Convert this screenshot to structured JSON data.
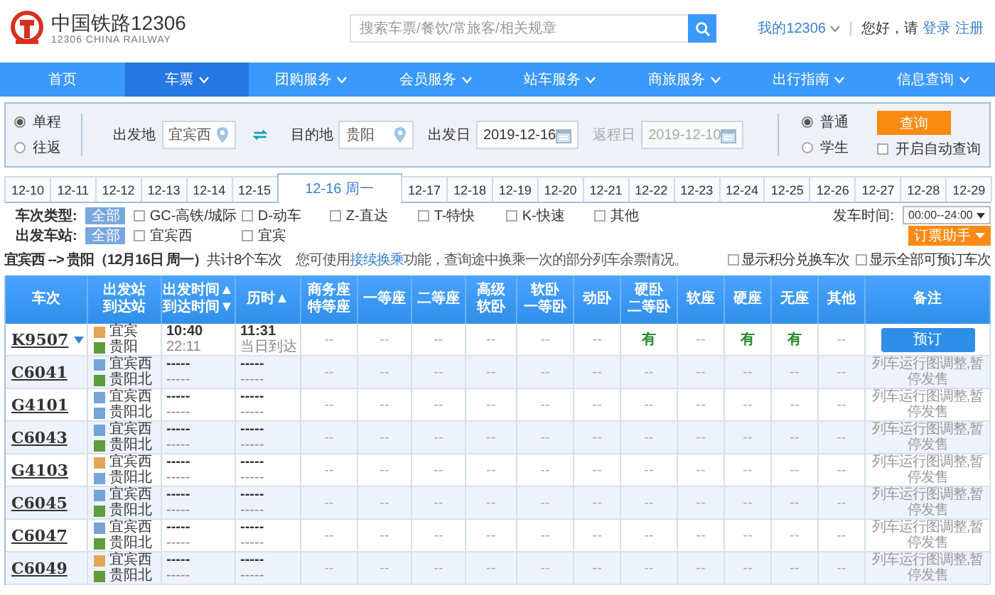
{
  "header": {
    "title": "中国铁路12306",
    "subtitle": "12306 CHINA RAILWAY",
    "search": {
      "placeholder": "搜索车票/餐饮/常旅客/相关规章"
    },
    "account": "我的12306",
    "greeting": "您好，请",
    "login": "登录",
    "register": "注册"
  },
  "nav": [
    {
      "label": "首页",
      "selected": false,
      "dropdown": false
    },
    {
      "label": "车票",
      "selected": true,
      "dropdown": true
    },
    {
      "label": "团购服务",
      "selected": false,
      "dropdown": true
    },
    {
      "label": "会员服务",
      "selected": false,
      "dropdown": true
    },
    {
      "label": "站车服务",
      "selected": false,
      "dropdown": true
    },
    {
      "label": "商旅服务",
      "selected": false,
      "dropdown": true
    },
    {
      "label": "出行指南",
      "selected": false,
      "dropdown": true
    },
    {
      "label": "信息查询",
      "selected": false,
      "dropdown": true
    }
  ],
  "query": {
    "trip_types": [
      {
        "label": "单程",
        "selected": true
      },
      {
        "label": "往返",
        "selected": false
      }
    ],
    "from": {
      "label": "出发地",
      "value": "宜宾西"
    },
    "to": {
      "label": "目的地",
      "value": "贵阳"
    },
    "depart": {
      "label": "出发日",
      "value": "2019-12-16",
      "disabled": false
    },
    "return": {
      "label": "返程日",
      "value": "2019-12-10",
      "disabled": true
    },
    "passenger_types": [
      {
        "label": "普通",
        "selected": true
      },
      {
        "label": "学生",
        "selected": false
      }
    ],
    "search_button": "查询",
    "auto_query": {
      "label": "开启自动查询",
      "checked": false
    }
  },
  "date_tabs": [
    {
      "label": "12-10",
      "selected": false
    },
    {
      "label": "12-11",
      "selected": false
    },
    {
      "label": "12-12",
      "selected": false
    },
    {
      "label": "12-13",
      "selected": false
    },
    {
      "label": "12-14",
      "selected": false
    },
    {
      "label": "12-15",
      "selected": false
    },
    {
      "label": "12-16 周一",
      "selected": true
    },
    {
      "label": "12-17",
      "selected": false
    },
    {
      "label": "12-18",
      "selected": false
    },
    {
      "label": "12-19",
      "selected": false
    },
    {
      "label": "12-20",
      "selected": false
    },
    {
      "label": "12-21",
      "selected": false
    },
    {
      "label": "12-22",
      "selected": false
    },
    {
      "label": "12-23",
      "selected": false
    },
    {
      "label": "12-24",
      "selected": false
    },
    {
      "label": "12-25",
      "selected": false
    },
    {
      "label": "12-26",
      "selected": false
    },
    {
      "label": "12-27",
      "selected": false
    },
    {
      "label": "12-28",
      "selected": false
    },
    {
      "label": "12-29",
      "selected": false
    }
  ],
  "filters": {
    "train_type": {
      "label": "车次类型:",
      "all": {
        "label": "全部",
        "selected": true
      },
      "options": [
        {
          "label": "GC-高铁/城际",
          "checked": false
        },
        {
          "label": "D-动车",
          "checked": false
        },
        {
          "label": "Z-直达",
          "checked": false
        },
        {
          "label": "T-特快",
          "checked": false
        },
        {
          "label": "K-快速",
          "checked": false
        },
        {
          "label": "其他",
          "checked": false
        }
      ]
    },
    "station": {
      "label": "出发车站:",
      "all": {
        "label": "全部",
        "selected": true
      },
      "options": [
        {
          "label": "宜宾西",
          "checked": false
        },
        {
          "label": "宜宾",
          "checked": false
        }
      ]
    },
    "depart_time": {
      "label": "发车时间:",
      "value": "00:00--24:00"
    },
    "helper_button": "订票助手"
  },
  "summary": {
    "route": "**宜宾西 --> 贵阳（12月16日  周一）**共计8个车次",
    "notice_before": "您可使用",
    "notice_link": "接续换乘",
    "notice_after": "功能，查询途中换乘一次的部分列车余票情况。",
    "options": [
      {
        "label": "显示积分兑换车次",
        "checked": false
      },
      {
        "label": "显示全部可预订车次",
        "checked": false
      }
    ]
  },
  "table": {
    "columns": [
      {
        "lines": [
          "车次"
        ]
      },
      {
        "lines": [
          "出发站",
          "到达站"
        ]
      },
      {
        "lines": [
          "出发时间▲",
          "到达时间▼"
        ]
      },
      {
        "lines": [
          "历时▲"
        ]
      },
      {
        "lines": [
          "商务座",
          "特等座"
        ]
      },
      {
        "lines": [
          "一等座"
        ]
      },
      {
        "lines": [
          "二等座"
        ]
      },
      {
        "lines": [
          "高级",
          "软卧"
        ]
      },
      {
        "lines": [
          "软卧",
          "一等卧"
        ]
      },
      {
        "lines": [
          "动卧"
        ]
      },
      {
        "lines": [
          "硬卧",
          "二等卧"
        ]
      },
      {
        "lines": [
          "软座"
        ]
      },
      {
        "lines": [
          "硬座"
        ]
      },
      {
        "lines": [
          "无座"
        ]
      },
      {
        "lines": [
          "其他"
        ]
      },
      {
        "lines": [
          "备注"
        ]
      }
    ],
    "rows": [
      {
        "train": "K9507",
        "expandable": true,
        "from": {
          "name": "宜宾",
          "kind": "start"
        },
        "to": {
          "name": "贵阳",
          "kind": "end"
        },
        "depart": "10:40",
        "arrive": "22:11",
        "duration": "11:31",
        "arrival_day": "当日到达",
        "seats": [
          {
            "text": "--",
            "available": false
          },
          {
            "text": "--",
            "available": false
          },
          {
            "text": "--",
            "available": false
          },
          {
            "text": "--",
            "available": false
          },
          {
            "text": "--",
            "available": false
          },
          {
            "text": "--",
            "available": false
          },
          {
            "text": "有",
            "available": true
          },
          {
            "text": "--",
            "available": false
          },
          {
            "text": "有",
            "available": true
          },
          {
            "text": "有",
            "available": true
          },
          {
            "text": "--",
            "available": false
          }
        ],
        "remark": {
          "kind": "button",
          "text": "预订"
        }
      },
      {
        "train": "C6041",
        "expandable": false,
        "from": {
          "name": "宜宾西",
          "kind": "pass"
        },
        "to": {
          "name": "贵阳北",
          "kind": "end"
        },
        "depart": "-----",
        "arrive": "-----",
        "duration": "-----",
        "arrival_day": "-----",
        "seats": [
          {
            "text": "--",
            "available": false
          },
          {
            "text": "--",
            "available": false
          },
          {
            "text": "--",
            "available": false
          },
          {
            "text": "--",
            "available": false
          },
          {
            "text": "--",
            "available": false
          },
          {
            "text": "--",
            "available": false
          },
          {
            "text": "--",
            "available": false
          },
          {
            "text": "--",
            "available": false
          },
          {
            "text": "--",
            "available": false
          },
          {
            "text": "--",
            "available": false
          },
          {
            "text": "--",
            "available": false
          }
        ],
        "remark": {
          "kind": "note",
          "text": "列车运行图调整,暂停发售"
        }
      },
      {
        "train": "G4101",
        "expandable": false,
        "from": {
          "name": "宜宾西",
          "kind": "pass"
        },
        "to": {
          "name": "贵阳北",
          "kind": "pass"
        },
        "depart": "-----",
        "arrive": "-----",
        "duration": "-----",
        "arrival_day": "-----",
        "seats": [
          {
            "text": "--",
            "available": false
          },
          {
            "text": "--",
            "available": false
          },
          {
            "text": "--",
            "available": false
          },
          {
            "text": "--",
            "available": false
          },
          {
            "text": "--",
            "available": false
          },
          {
            "text": "--",
            "available": false
          },
          {
            "text": "--",
            "available": false
          },
          {
            "text": "--",
            "available": false
          },
          {
            "text": "--",
            "available": false
          },
          {
            "text": "--",
            "available": false
          },
          {
            "text": "--",
            "available": false
          }
        ],
        "remark": {
          "kind": "note",
          "text": "列车运行图调整,暂停发售"
        }
      },
      {
        "train": "C6043",
        "expandable": false,
        "from": {
          "name": "宜宾西",
          "kind": "pass"
        },
        "to": {
          "name": "贵阳北",
          "kind": "end"
        },
        "depart": "-----",
        "arrive": "-----",
        "duration": "-----",
        "arrival_day": "-----",
        "seats": [
          {
            "text": "--",
            "available": false
          },
          {
            "text": "--",
            "available": false
          },
          {
            "text": "--",
            "available": false
          },
          {
            "text": "--",
            "available": false
          },
          {
            "text": "--",
            "available": false
          },
          {
            "text": "--",
            "available": false
          },
          {
            "text": "--",
            "available": false
          },
          {
            "text": "--",
            "available": false
          },
          {
            "text": "--",
            "available": false
          },
          {
            "text": "--",
            "available": false
          },
          {
            "text": "--",
            "available": false
          }
        ],
        "remark": {
          "kind": "note",
          "text": "列车运行图调整,暂停发售"
        }
      },
      {
        "train": "G4103",
        "expandable": false,
        "from": {
          "name": "宜宾西",
          "kind": "start"
        },
        "to": {
          "name": "贵阳北",
          "kind": "pass"
        },
        "depart": "-----",
        "arrive": "-----",
        "duration": "-----",
        "arrival_day": "-----",
        "seats": [
          {
            "text": "--",
            "available": false
          },
          {
            "text": "--",
            "available": false
          },
          {
            "text": "--",
            "available": false
          },
          {
            "text": "--",
            "available": false
          },
          {
            "text": "--",
            "available": false
          },
          {
            "text": "--",
            "available": false
          },
          {
            "text": "--",
            "available": false
          },
          {
            "text": "--",
            "available": false
          },
          {
            "text": "--",
            "available": false
          },
          {
            "text": "--",
            "available": false
          },
          {
            "text": "--",
            "available": false
          }
        ],
        "remark": {
          "kind": "note",
          "text": "列车运行图调整,暂停发售"
        }
      },
      {
        "train": "C6045",
        "expandable": false,
        "from": {
          "name": "宜宾西",
          "kind": "pass"
        },
        "to": {
          "name": "贵阳北",
          "kind": "end"
        },
        "depart": "-----",
        "arrive": "-----",
        "duration": "-----",
        "arrival_day": "-----",
        "seats": [
          {
            "text": "--",
            "available": false
          },
          {
            "text": "--",
            "available": false
          },
          {
            "text": "--",
            "available": false
          },
          {
            "text": "--",
            "available": false
          },
          {
            "text": "--",
            "available": false
          },
          {
            "text": "--",
            "available": false
          },
          {
            "text": "--",
            "available": false
          },
          {
            "text": "--",
            "available": false
          },
          {
            "text": "--",
            "available": false
          },
          {
            "text": "--",
            "available": false
          },
          {
            "text": "--",
            "available": false
          }
        ],
        "remark": {
          "kind": "note",
          "text": "列车运行图调整,暂停发售"
        }
      },
      {
        "train": "C6047",
        "expandable": false,
        "from": {
          "name": "宜宾西",
          "kind": "pass"
        },
        "to": {
          "name": "贵阳北",
          "kind": "end"
        },
        "depart": "-----",
        "arrive": "-----",
        "duration": "-----",
        "arrival_day": "-----",
        "seats": [
          {
            "text": "--",
            "available": false
          },
          {
            "text": "--",
            "available": false
          },
          {
            "text": "--",
            "available": false
          },
          {
            "text": "--",
            "available": false
          },
          {
            "text": "--",
            "available": false
          },
          {
            "text": "--",
            "available": false
          },
          {
            "text": "--",
            "available": false
          },
          {
            "text": "--",
            "available": false
          },
          {
            "text": "--",
            "available": false
          },
          {
            "text": "--",
            "available": false
          },
          {
            "text": "--",
            "available": false
          }
        ],
        "remark": {
          "kind": "note",
          "text": "列车运行图调整,暂停发售"
        }
      },
      {
        "train": "C6049",
        "expandable": false,
        "from": {
          "name": "宜宾西",
          "kind": "start"
        },
        "to": {
          "name": "贵阳北",
          "kind": "end"
        },
        "depart": "-----",
        "arrive": "-----",
        "duration": "-----",
        "arrival_day": "-----",
        "seats": [
          {
            "text": "--",
            "available": false
          },
          {
            "text": "--",
            "available": false
          },
          {
            "text": "--",
            "available": false
          },
          {
            "text": "--",
            "available": false
          },
          {
            "text": "--",
            "available": false
          },
          {
            "text": "--",
            "available": false
          },
          {
            "text": "--",
            "available": false
          },
          {
            "text": "--",
            "available": false
          },
          {
            "text": "--",
            "available": false
          },
          {
            "text": "--",
            "available": false
          },
          {
            "text": "--",
            "available": false
          }
        ],
        "remark": {
          "kind": "note",
          "text": "列车运行图调整,暂停发售"
        }
      }
    ]
  }
}
